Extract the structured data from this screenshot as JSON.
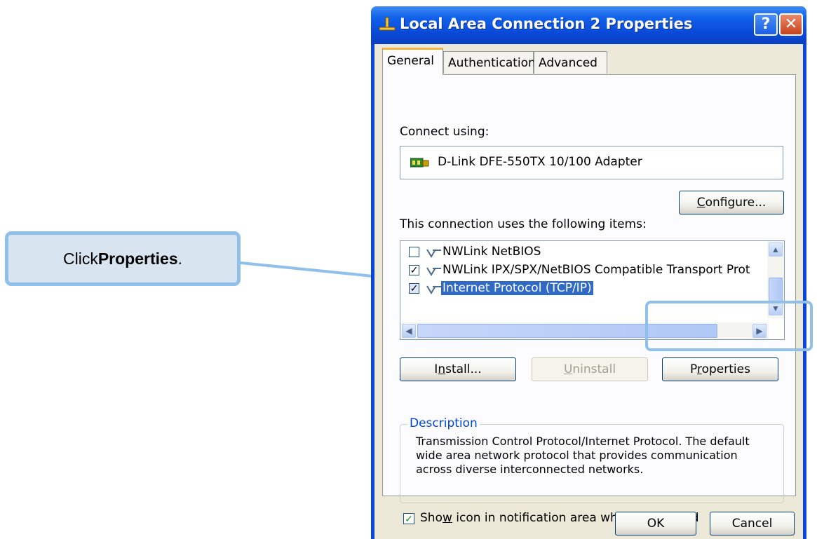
{
  "callout": {
    "prefix": "Click ",
    "bold": "Properties",
    "suffix": "."
  },
  "window": {
    "title": "Local Area Connection 2 Properties",
    "help_label": "?",
    "close_label": "✕"
  },
  "tabs": [
    {
      "label": "General",
      "active": true
    },
    {
      "label": "Authentication",
      "active": false
    },
    {
      "label": "Advanced",
      "active": false
    }
  ],
  "general": {
    "connect_using_label": "Connect using:",
    "adapter_name": "D-Link DFE-550TX 10/100 Adapter",
    "configure_button": "Configure...",
    "items_label": "This connection uses the following items:",
    "items": [
      {
        "label": "NWLink NetBIOS",
        "checked": false,
        "selected": false
      },
      {
        "label": "NWLink IPX/SPX/NetBIOS Compatible Transport Prot",
        "checked": true,
        "selected": false
      },
      {
        "label": "Internet Protocol (TCP/IP)",
        "checked": true,
        "selected": true
      }
    ],
    "install_button": "Install...",
    "uninstall_button": "Uninstall",
    "properties_button": "Properties",
    "description_title": "Description",
    "description_text": "Transmission Control Protocol/Internet Protocol. The default wide area network protocol that provides communication across diverse interconnected networks.",
    "show_icon_label": "Show icon in notification area when connected",
    "show_icon_checked": true
  },
  "footer": {
    "ok_button": "OK",
    "cancel_button": "Cancel"
  },
  "colors": {
    "callout_fill": "#d8e4f0",
    "callout_border": "#8fc0ec",
    "titlebar": "#0a4ad8",
    "selection": "#316ac5"
  }
}
